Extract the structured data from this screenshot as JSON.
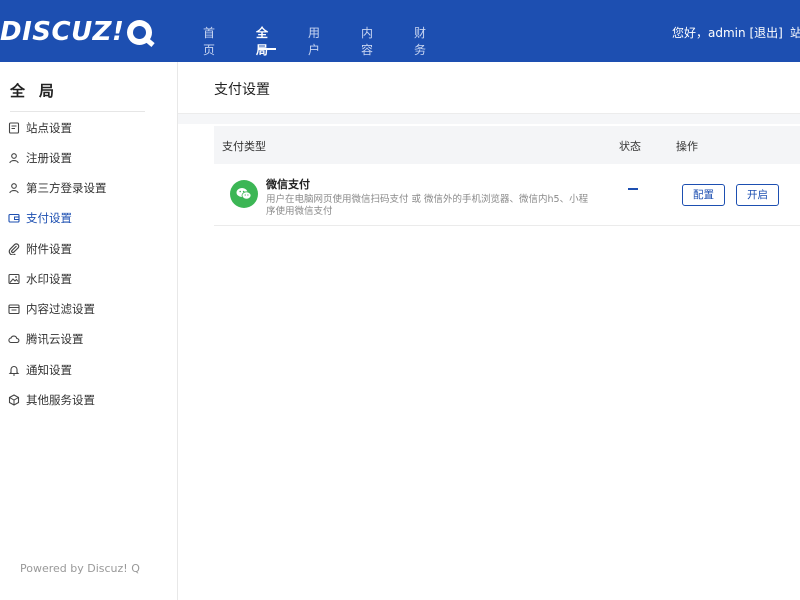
{
  "header": {
    "logo_text": "DISCUZ!",
    "logo_mark": "Q",
    "nav": [
      {
        "label": "首页"
      },
      {
        "label": "全局"
      },
      {
        "label": "用户"
      },
      {
        "label": "内容"
      },
      {
        "label": "财务"
      }
    ],
    "active_nav": "全局",
    "greeting": "您好，admin",
    "logout_label": "[退出]",
    "extra_label": "站"
  },
  "sidebar": {
    "title": "全局",
    "items": [
      {
        "label": "站点设置",
        "icon": "document-icon"
      },
      {
        "label": "注册设置",
        "icon": "user-icon"
      },
      {
        "label": "第三方登录设置",
        "icon": "user-icon"
      },
      {
        "label": "支付设置",
        "icon": "wallet-icon"
      },
      {
        "label": "附件设置",
        "icon": "paperclip-icon"
      },
      {
        "label": "水印设置",
        "icon": "image-icon"
      },
      {
        "label": "内容过滤设置",
        "icon": "filter-icon"
      },
      {
        "label": "腾讯云设置",
        "icon": "cloud-icon"
      },
      {
        "label": "通知设置",
        "icon": "bell-icon"
      },
      {
        "label": "其他服务设置",
        "icon": "cube-icon"
      }
    ],
    "active_item": "支付设置",
    "powered_by": "Powered by Discuz! Q"
  },
  "main": {
    "page_title": "支付设置",
    "table": {
      "headers": [
        "支付类型",
        "状态",
        "操作"
      ],
      "rows": [
        {
          "name": "微信支付",
          "description": "用户在电脑网页使用微信扫码支付 或 微信外的手机浏览器、微信内h5、小程序使用微信支付",
          "status": "–",
          "actions": [
            "配置",
            "开启"
          ]
        }
      ]
    }
  },
  "colors": {
    "header_bg": "#1d4fb1",
    "accent": "#1d4fb1",
    "wechat_green": "#3cb655"
  }
}
